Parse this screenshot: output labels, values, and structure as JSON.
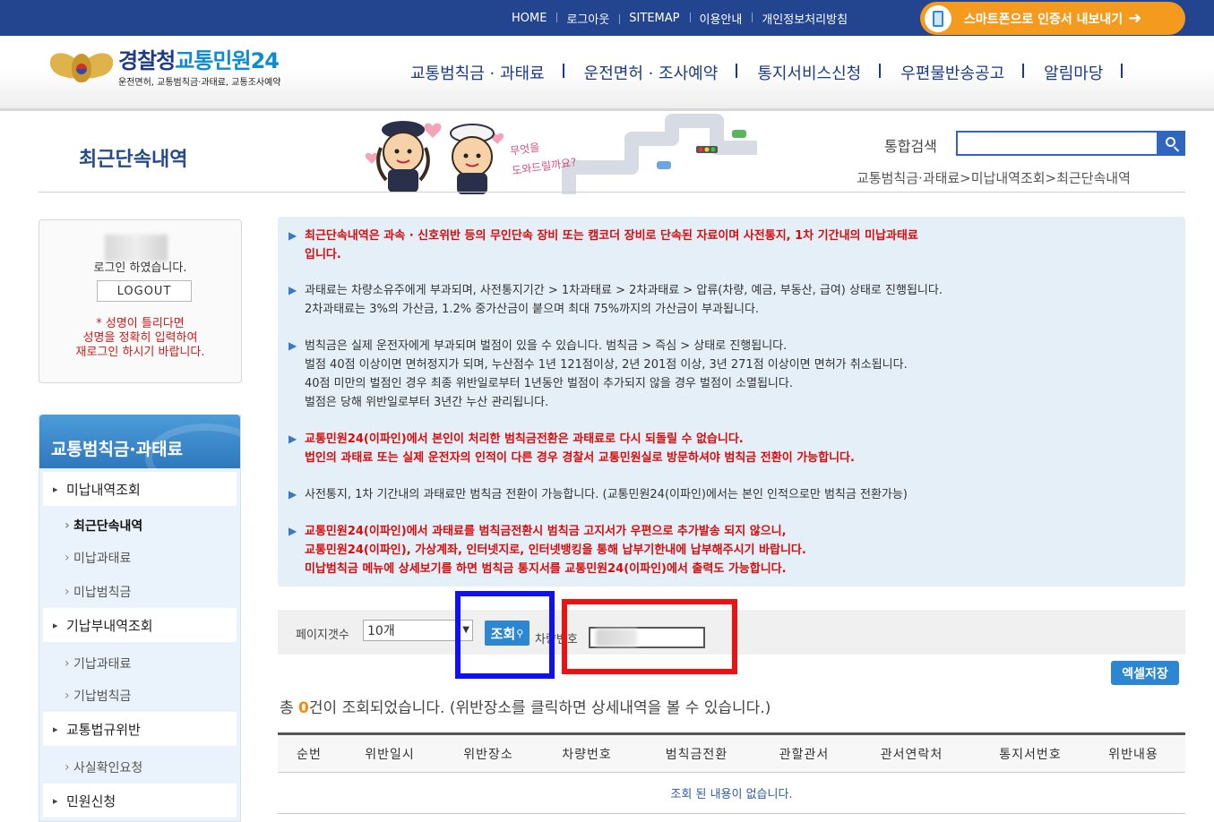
{
  "topbar": {
    "links": [
      "HOME",
      "로그아웃",
      "SITEMAP",
      "이용안내",
      "개인정보처리방침"
    ],
    "smart_button": "스마트폰으로 인증서 내보내기"
  },
  "header": {
    "logo_title_1": "경찰청",
    "logo_title_2": "교통민원24",
    "logo_subtitle": "운전면허, 교통범칙금·과태료, 교통조사예약",
    "gnb": [
      "교통범칙금 · 과태료",
      "운전면허 · 조사예약",
      "통지서비스신청",
      "우편물반송공고",
      "알림마당"
    ]
  },
  "page": {
    "title": "최근단속내역",
    "mascot_text": "무엇을 도와드릴까요?",
    "search_label": "통합검색",
    "breadcrumb": "교통범칙금·과태료>미납내역조회>최근단속내역"
  },
  "login": {
    "message": "로그인 하였습니다.",
    "logout_label": "LOGOUT",
    "warning_1": "* 성명이 틀리다면",
    "warning_2": "성명을 정확히 입력하여",
    "warning_3": "재로그인 하시기 바랍니다."
  },
  "lnb": {
    "title": "교통범칙금·과태료",
    "items": [
      {
        "label": "미납내역조회",
        "level": "main"
      },
      {
        "label": "최근단속내역",
        "level": "sub",
        "active": true
      },
      {
        "label": "미납과태료",
        "level": "sub"
      },
      {
        "label": "미납범칙금",
        "level": "sub"
      },
      {
        "label": "기납부내역조회",
        "level": "main"
      },
      {
        "label": "기납과태료",
        "level": "sub"
      },
      {
        "label": "기납범칙금",
        "level": "sub"
      },
      {
        "label": "교통법규위반",
        "level": "main"
      },
      {
        "label": "사실확인요청",
        "level": "sub"
      },
      {
        "label": "민원신청",
        "level": "main"
      }
    ]
  },
  "notice": {
    "n1_l1": "최근단속내역은 과속 · 신호위반 등의 무인단속 장비 또는 캠코더 장비로 단속된 자료이며 사전통지, 1차 기간내의 미납과태료",
    "n1_l2": "입니다.",
    "n2_l1": "과태료는 차량소유주에게 부과되며, 사전통지기간 > 1차과태료 > 2차과태료 > 압류(차량, 예금, 부동산, 급여) 상태로 진행됩니다.",
    "n2_l2": "2차과태료는 3%의 가산금, 1.2% 중가산금이 붙으며 최대 75%까지의 가산금이 부과됩니다.",
    "n3_l1": "범칙금은 실제 운전자에게 부과되며 벌점이 있을 수 있습니다. 범칙금 > 즉심 > 상태로 진행됩니다.",
    "n3_l2": "벌점 40점 이상이면 면허정지가 되며, 누산점수 1년 121점이상, 2년 201점 이상, 3년 271점 이상이면 면허가 취소됩니다.",
    "n3_l3": "40점 미만의 벌점인 경우 최종 위반일로부터 1년동안 벌점이 추가되지 않을 경우 벌점이 소멸됩니다.",
    "n3_l4": "벌점은 당해 위반일로부터 3년간 누산 관리됩니다.",
    "n4_l1": "교통민원24(이파인)에서 본인이 처리한 범칙금전환은 과태료로 다시 되돌릴 수 없습니다.",
    "n4_l2": "법인의 과태료 또는 실제 운전자의 인적이 다른 경우 경찰서 교통민원실로 방문하셔야 범칙금 전환이 가능합니다.",
    "n5_l1": "사전통지, 1차 기간내의 과태료만 범칙금 전환이 가능합니다. (교통민원24(이파인)에서는 본인 인적으로만 범칙금 전환가능)",
    "n6_l1": "교통민원24(이파인)에서 과태료를 범칙금전환시 범칙금 고지서가 우편으로 추가발송 되지 않으니,",
    "n6_l2": "교통민원24(이파인), 가상계좌, 인터넷지로, 인터넷뱅킹을 통해 납부기한내에 납부해주시기 바랍니다.",
    "n6_l3": "미납범칙금 메뉴에 상세보기를 하면 범칙금 통지서를 교통민원24(이파인)에서 출력도 가능합니다."
  },
  "controls": {
    "page_count_label": "페이지갯수",
    "page_count_value": "10개",
    "search_button": "조회",
    "plate_label": "차량번호",
    "excel_button": "엑셀저장"
  },
  "result": {
    "prefix": "총 ",
    "count": "0",
    "suffix": "건이 조회되었습니다. (위반장소를 클릭하면 상세내역을 볼 수 있습니다.)"
  },
  "table": {
    "headers": [
      "순번",
      "위반일시",
      "위반장소",
      "차량번호",
      "범칙금전환",
      "관할관서",
      "관서연락처",
      "통지서번호",
      "위반내용"
    ],
    "empty_text": "조회 된 내용이 없습니다."
  },
  "colors": {
    "topbar": "#23448f",
    "accent_orange": "#f39a1f",
    "highlight_blue": "#1111ee",
    "highlight_red": "#ee1111",
    "notice_red": "#d80c0c"
  }
}
